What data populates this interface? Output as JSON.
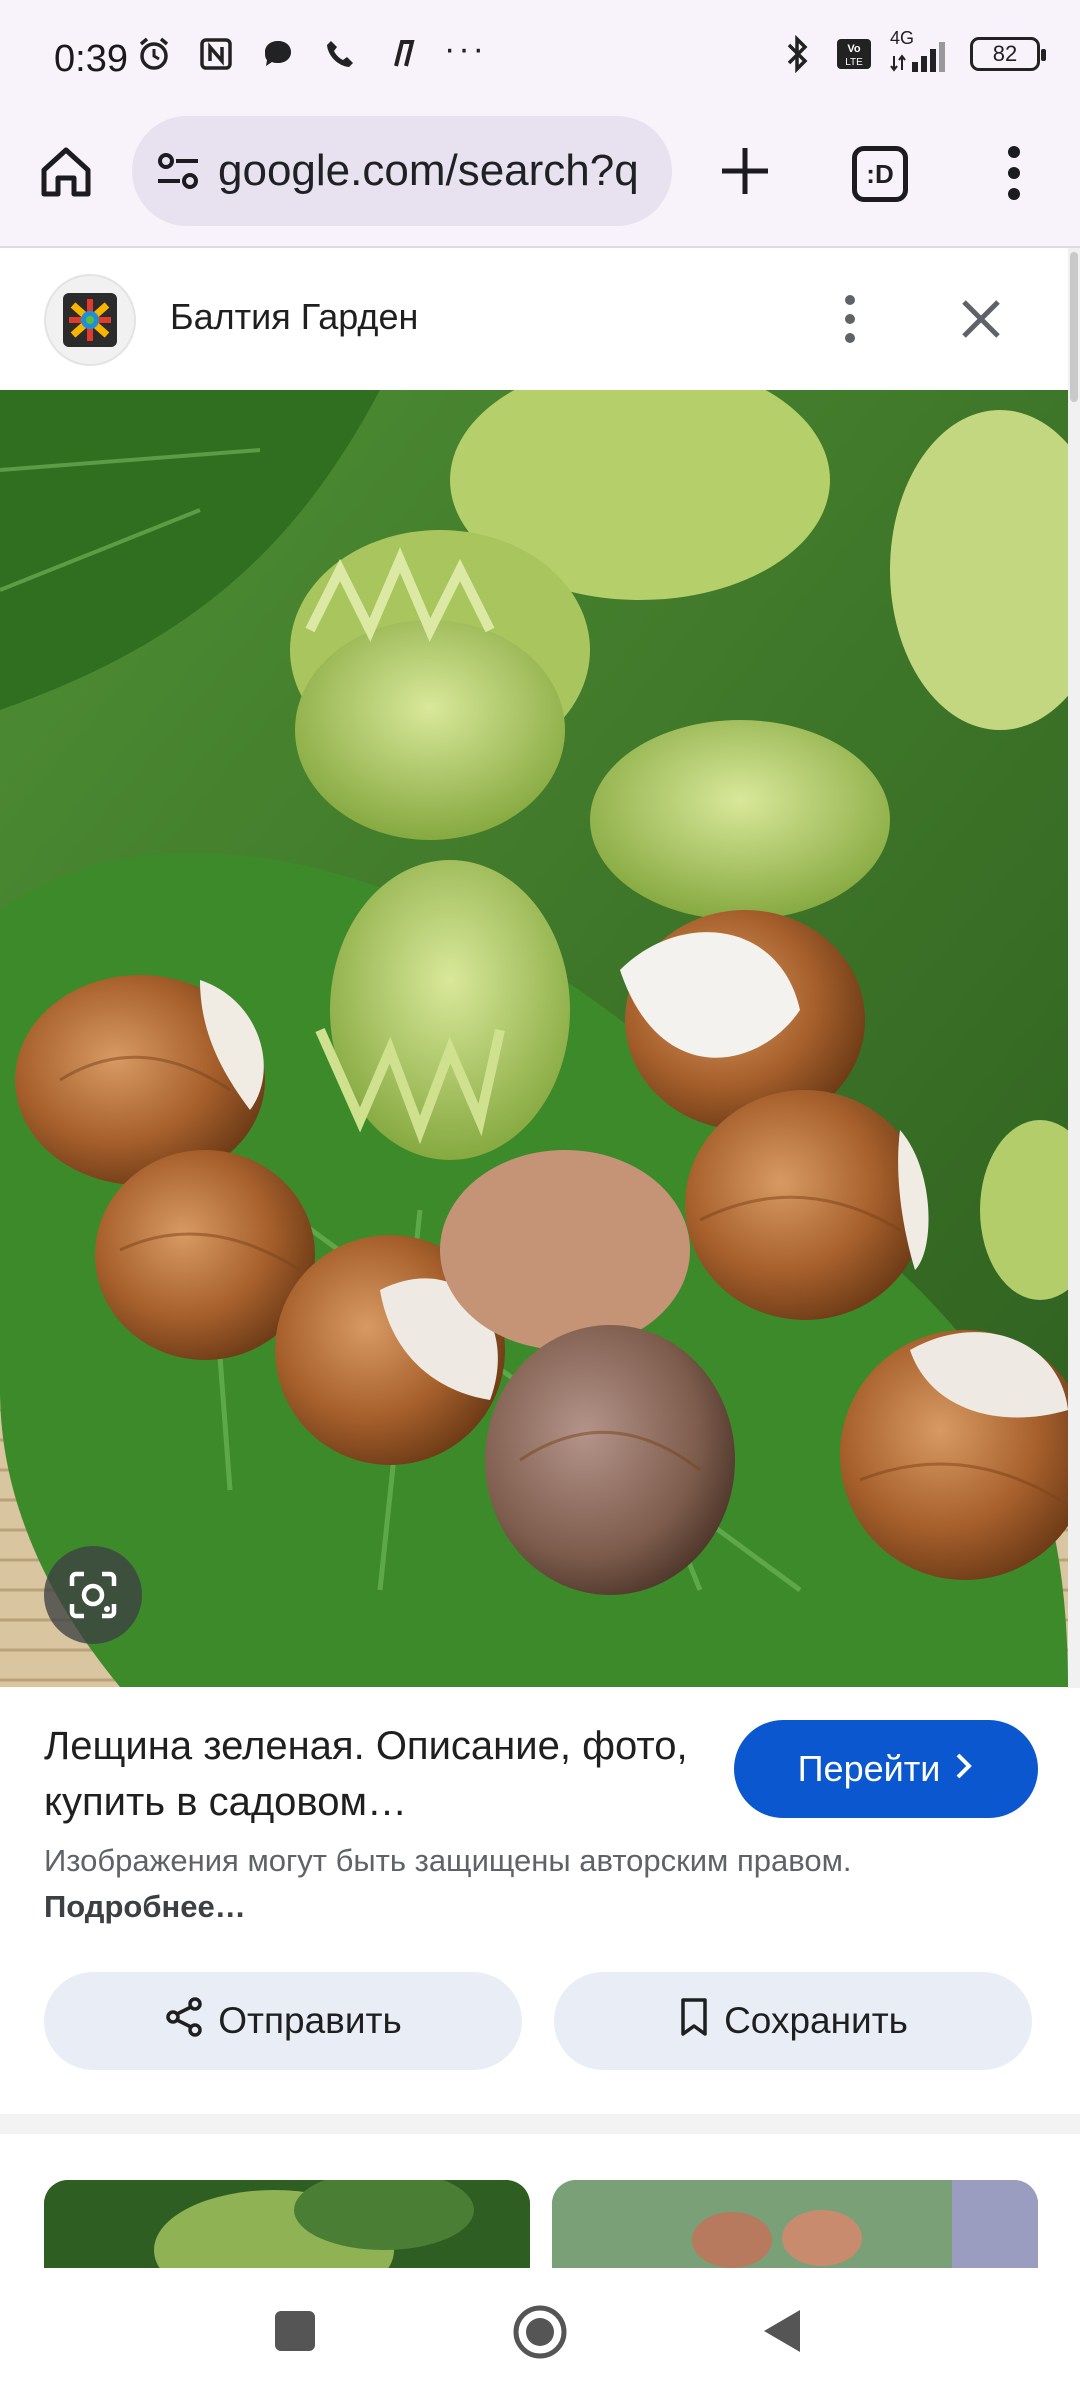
{
  "status_bar": {
    "time": "0:39",
    "network": "4G",
    "battery": "82",
    "more": "···"
  },
  "browser": {
    "url": "google.com/search?q",
    "tab_label": ":D"
  },
  "source": {
    "name": "Балтия Гарден"
  },
  "result": {
    "title": "Лещина зеленая. Описание, фото, купить в садовом…",
    "visit_label": "Перейти",
    "copyright_text": "Изображения могут быть защищены авторским правом. ",
    "more_link": "Подробнее…"
  },
  "actions": {
    "share_label": "Отправить",
    "save_label": "Сохранить"
  },
  "icons": {
    "home": "home-icon",
    "tune": "site-info-icon",
    "plus": "new-tab-icon",
    "menu": "more-vert-icon",
    "lens": "google-lens-icon",
    "share": "share-icon",
    "bookmark": "bookmark-icon",
    "close": "close-icon"
  },
  "colors": {
    "accent": "#0b57d0",
    "toolbar_bg": "#f8f2fb",
    "url_bg": "#e8e2f0",
    "action_bg": "#e9eef6"
  }
}
